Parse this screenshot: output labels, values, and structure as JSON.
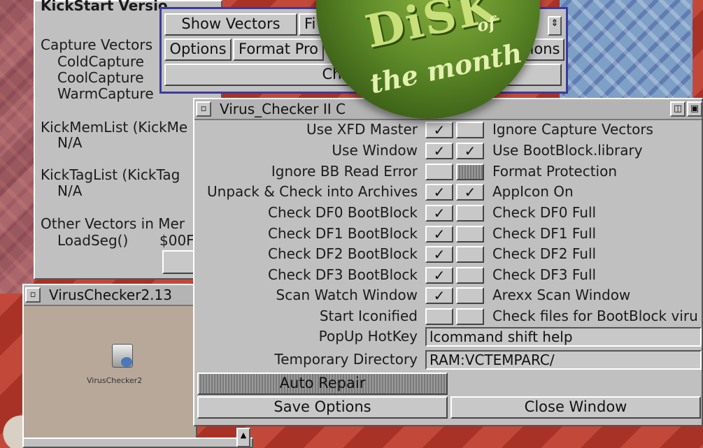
{
  "kickstart_window": {
    "title": "KickStart Versio",
    "capture_header": "Capture Vectors",
    "capture_items": [
      "ColdCapture",
      "CoolCapture",
      "WarmCapture"
    ],
    "kickmemlist_label": "KickMemList (KickMe",
    "kickmemlist_value": "N/A",
    "kicktaglist_label": "KickTagList (KickTag",
    "kicktaglist_value": "N/A",
    "other_vectors_label": "Other Vectors in Mer",
    "loadseg_label": "LoadSeg()",
    "loadseg_value": "$00F"
  },
  "top_window": {
    "show_vectors": "Show Vectors",
    "fi_button": "Fi",
    "options": "Options",
    "format_pro": "Format Pro",
    "ions": "ions",
    "check_now": "Check Now"
  },
  "badge": {
    "big": "DiSK",
    "small": "of",
    "sub": "the month"
  },
  "iconified_window": {
    "title": "VirusChecker2.13",
    "icon_label": "VirusChecker2"
  },
  "main_window": {
    "title": "Virus_Checker II C",
    "left_options": [
      {
        "label": "Use XFD Master",
        "checked": true
      },
      {
        "label": "Use Window",
        "checked": true
      },
      {
        "label": "Ignore BB Read Error",
        "checked": false
      },
      {
        "label": "Unpack & Check into Archives",
        "checked": true
      },
      {
        "label": "Check DF0 BootBlock",
        "checked": true
      },
      {
        "label": "Check DF1 BootBlock",
        "checked": true
      },
      {
        "label": "Check DF2 BootBlock",
        "checked": true
      },
      {
        "label": "Check DF3 BootBlock",
        "checked": true
      },
      {
        "label": "Scan Watch Window",
        "checked": true
      },
      {
        "label": "Start Iconified",
        "checked": false
      }
    ],
    "right_options": [
      {
        "label": "Ignore Capture Vectors",
        "checked": false
      },
      {
        "label": "Use BootBlock.library",
        "checked": true
      },
      {
        "label": "Format Protection",
        "checked": false
      },
      {
        "label": "AppIcon On",
        "checked": true
      },
      {
        "label": "Check DF0 Full",
        "checked": false
      },
      {
        "label": "Check DF1 Full",
        "checked": false
      },
      {
        "label": "Check DF2 Full",
        "checked": false
      },
      {
        "label": "Check DF3 Full",
        "checked": false
      },
      {
        "label": "Arexx Scan Window",
        "checked": false
      },
      {
        "label": "Check files for BootBlock viru",
        "checked": false
      }
    ],
    "popup_hotkey_label": "PopUp HotKey",
    "popup_hotkey_value": "lcommand shift help",
    "temp_dir_label": "Temporary Directory",
    "temp_dir_value": "RAM:VCTEMPARC/",
    "auto_repair": "Auto Repair",
    "save_options": "Save Options",
    "close_window": "Close Window"
  },
  "check_glyph": "✓"
}
